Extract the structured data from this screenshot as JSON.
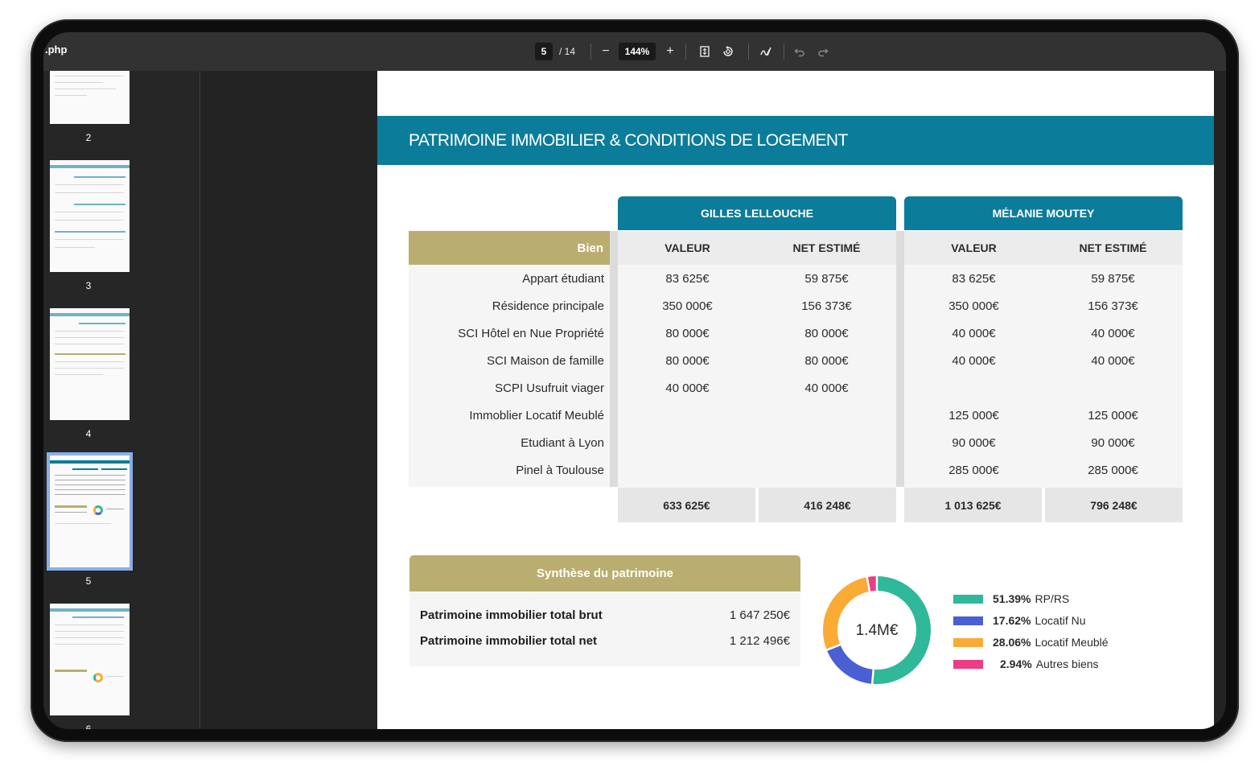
{
  "toolbar": {
    "file_name": ".php",
    "page_current": "5",
    "page_total": "/ 14",
    "zoom": "144%",
    "zoom_out": "−",
    "zoom_in": "+"
  },
  "sidebar": {
    "thumbnails": [
      {
        "label": "2"
      },
      {
        "label": "3"
      },
      {
        "label": "4"
      },
      {
        "label": "5",
        "active": true
      },
      {
        "label": "6"
      }
    ]
  },
  "document": {
    "title": "PATRIMOINE IMMOBILIER & CONDITIONS DE LOGEMENT",
    "bien_header": "Bien",
    "persons": [
      {
        "name": "GILLES LELLOUCHE",
        "col_value": "VALEUR",
        "col_net": "NET ESTIMÉ",
        "total_value": "633 625€",
        "total_net": "416 248€"
      },
      {
        "name": "MÉLANIE MOUTEY",
        "col_value": "VALEUR",
        "col_net": "NET ESTIMÉ",
        "total_value": "1 013 625€",
        "total_net": "796 248€"
      }
    ],
    "rows": [
      {
        "label": "Appart étudiant",
        "p1_value": "83 625€",
        "p1_net": "59 875€",
        "p2_value": "83 625€",
        "p2_net": "59 875€"
      },
      {
        "label": "Résidence principale",
        "p1_value": "350 000€",
        "p1_net": "156 373€",
        "p2_value": "350 000€",
        "p2_net": "156 373€"
      },
      {
        "label": "SCI Hôtel en Nue Propriété",
        "p1_value": "80 000€",
        "p1_net": "80 000€",
        "p2_value": "40 000€",
        "p2_net": "40 000€"
      },
      {
        "label": "SCI Maison de famille",
        "p1_value": "80 000€",
        "p1_net": "80 000€",
        "p2_value": "40 000€",
        "p2_net": "40 000€"
      },
      {
        "label": "SCPI Usufruit viager",
        "p1_value": "40 000€",
        "p1_net": "40 000€",
        "p2_value": "",
        "p2_net": ""
      },
      {
        "label": "Immoblier Locatif Meublé",
        "p1_value": "",
        "p1_net": "",
        "p2_value": "125 000€",
        "p2_net": "125 000€"
      },
      {
        "label": "Etudiant à Lyon",
        "p1_value": "",
        "p1_net": "",
        "p2_value": "90 000€",
        "p2_net": "90 000€"
      },
      {
        "label": "Pinel à Toulouse",
        "p1_value": "",
        "p1_net": "",
        "p2_value": "285 000€",
        "p2_net": "285 000€"
      }
    ],
    "synthese": {
      "title": "Synthèse du patrimoine",
      "brut_label": "Patrimoine immobilier total brut",
      "brut_value": "1 647 250€",
      "net_label": "Patrimoine immobilier total net",
      "net_value": "1 212 496€"
    }
  },
  "chart_data": {
    "type": "pie",
    "center_label": "1.4M€",
    "slices": [
      {
        "label": "RP/RS",
        "percent_text": "51.39%",
        "value": 51.39,
        "color": "#2fb89a"
      },
      {
        "label": "Locatif Nu",
        "percent_text": "17.62%",
        "value": 17.62,
        "color": "#4a5fd4"
      },
      {
        "label": "Locatif Meublé",
        "percent_text": "28.06%",
        "value": 28.06,
        "color": "#f9ab35"
      },
      {
        "label": "Autres biens",
        "percent_text": "2.94%",
        "value": 2.94,
        "color": "#ee3c85"
      }
    ]
  },
  "colors": {
    "teal": "#0b7c99",
    "gold": "#b9ae70"
  }
}
